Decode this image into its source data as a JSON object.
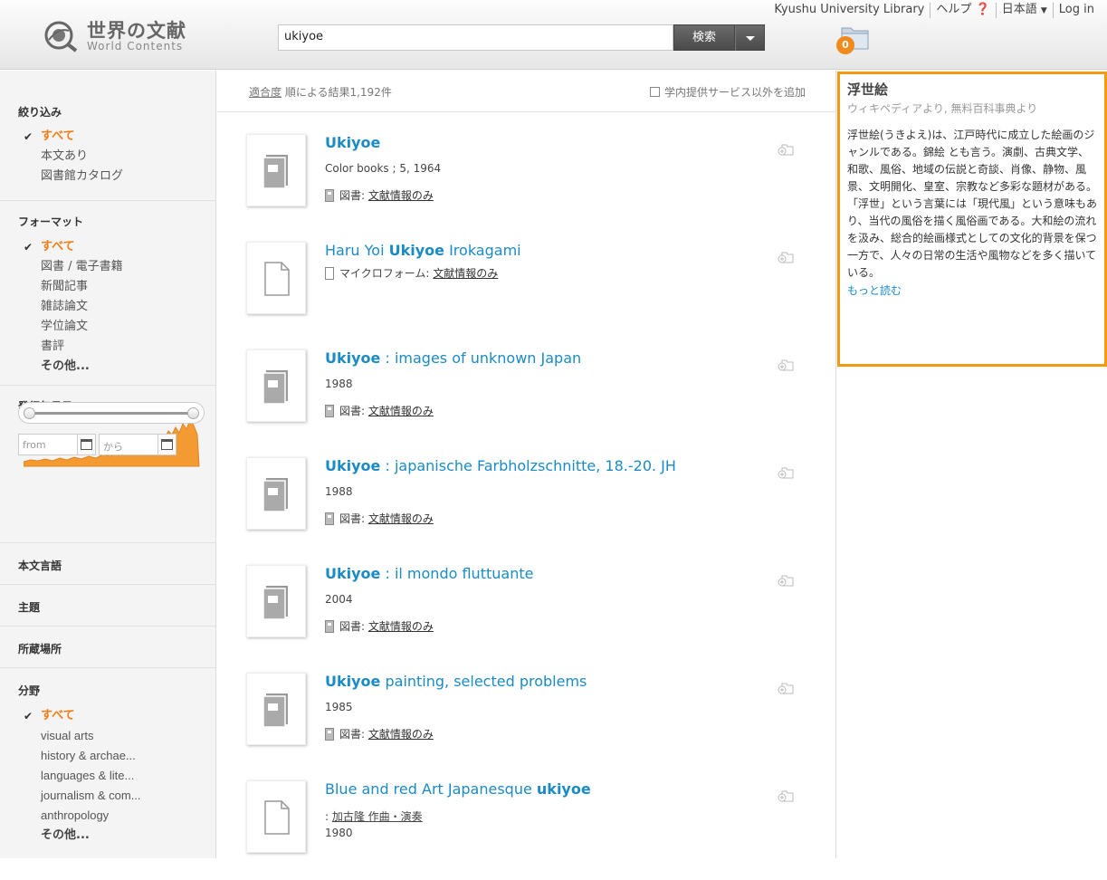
{
  "header": {
    "logo_jp": "世界の文献",
    "logo_en": "World Contents",
    "search_value": "ukiyoe",
    "search_button": "検索",
    "folder_count": "0",
    "nav": [
      "Kyushu University Library",
      "ヘルプ",
      "日本語",
      "Log in"
    ]
  },
  "sidebar": {
    "refine": {
      "title": "絞り込み",
      "items": [
        {
          "label": "すべて",
          "active": true
        },
        {
          "label": "本文あり",
          "active": false
        },
        {
          "label": "図書館カタログ",
          "active": false
        }
      ]
    },
    "format": {
      "title": "フォーマット",
      "items": [
        {
          "label": "すべて",
          "active": true
        },
        {
          "label": "図書 / 電子書籍",
          "active": false
        },
        {
          "label": "新聞記事",
          "active": false
        },
        {
          "label": "雑誌論文",
          "active": false
        },
        {
          "label": "学位論文",
          "active": false
        },
        {
          "label": "書評",
          "active": false
        },
        {
          "label": "その他...",
          "active": false
        }
      ]
    },
    "date": {
      "title": "発行年月日",
      "from_placeholder": "from",
      "to_placeholder": "から"
    },
    "language_title": "本文言語",
    "subject_title": "主題",
    "location_title": "所蔵場所",
    "field": {
      "title": "分野",
      "items": [
        {
          "label": "すべて",
          "active": true
        },
        {
          "label": "visual arts",
          "active": false
        },
        {
          "label": "history & archae...",
          "active": false
        },
        {
          "label": "languages & lite...",
          "active": false
        },
        {
          "label": "journalism & com...",
          "active": false
        },
        {
          "label": "anthropology",
          "active": false
        },
        {
          "label": "その他...",
          "active": false
        }
      ]
    }
  },
  "sortbar": {
    "sort_link": "適合度",
    "sort_text": " 順による結果1,192件",
    "add_services": "学内提供サービス以外を追加"
  },
  "results": [
    {
      "title_bold": "Ukiyoe",
      "title_rest": "",
      "line1": "Color books ; 5, 1964",
      "fmt_label": "図書:",
      "fmt_link": "文献情報のみ",
      "kind": "book"
    },
    {
      "title_pre": "Haru Yoi ",
      "title_bold": "Ukiyoe",
      "title_rest": " Irokagami",
      "line1": "",
      "fmt_label": "マイクロフォーム:",
      "fmt_link": "文献情報のみ",
      "kind": "doc"
    },
    {
      "title_bold": "Ukiyoe",
      "title_rest": " : images of unknown Japan",
      "line1": "1988",
      "fmt_label": "図書:",
      "fmt_link": "文献情報のみ",
      "kind": "book"
    },
    {
      "title_bold": "Ukiyoe",
      "title_rest": " : japanische Farbholzschnitte, 18.-20. JH",
      "line1": "1988",
      "fmt_label": "図書:",
      "fmt_link": "文献情報のみ",
      "kind": "book"
    },
    {
      "title_bold": "Ukiyoe",
      "title_rest": " : il mondo fluttuante",
      "line1": "2004",
      "fmt_label": "図書:",
      "fmt_link": "文献情報のみ",
      "kind": "book"
    },
    {
      "title_bold": "Ukiyoe",
      "title_rest": " painting, selected problems",
      "line1": "1985",
      "fmt_label": "図書:",
      "fmt_link": "文献情報のみ",
      "kind": "book"
    },
    {
      "title_pre": "Blue and red Art Japanesque ",
      "title_bold": "ukiyoe",
      "title_rest": "",
      "author": "加古隆 作曲・演奏",
      "line1": "1980",
      "kind": "doc"
    }
  ],
  "wiki": {
    "title": "浮世絵",
    "source": "ウィキペディアより, 無料百科事典より",
    "body": "浮世絵(うきよえ)は、江戸時代に成立した絵画のジャンルである。錦絵 とも言う。演劇、古典文学、和歌、風俗、地域の伝説と奇談、肖像、静物、風景、文明開化、皇室、宗教など多彩な題材がある。「浮世」という言葉には「現代風」という意味もあり、当代の風俗を描く風俗画である。大和絵の流れを汲み、総合的絵画様式としての文化的背景を保つ一方で、人々の日常の生活や風物などを多く描いている。",
    "more": "もっと読む"
  },
  "colors": {
    "accent": "#f07c16",
    "link": "#1b8bc5",
    "wiki_border": "#f39a12"
  }
}
